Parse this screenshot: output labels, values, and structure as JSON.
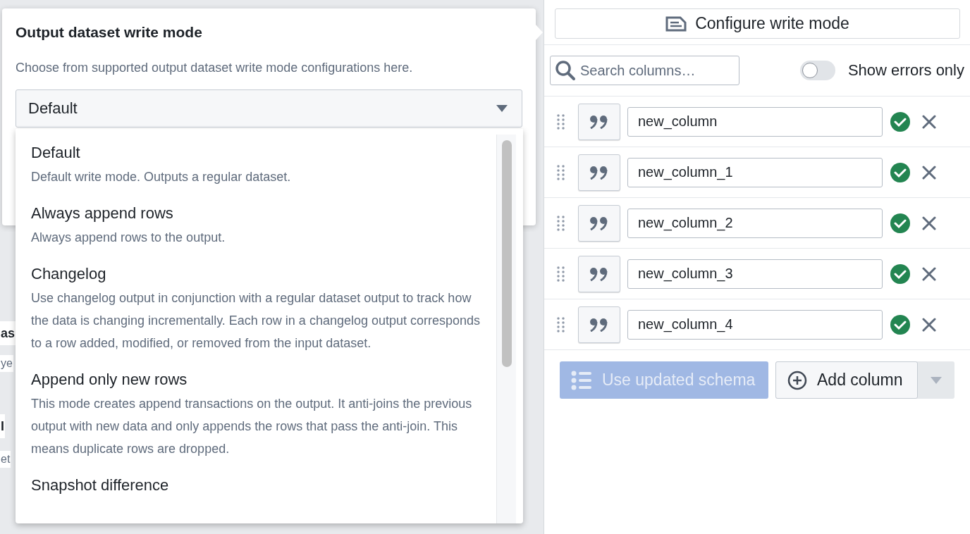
{
  "background": {
    "fragments": [
      "as",
      "ye",
      "I",
      "et"
    ]
  },
  "write_mode_popover": {
    "title": "Output dataset write mode",
    "description": "Choose from supported output dataset write mode configurations here.",
    "select": {
      "value": "Default"
    },
    "options": [
      {
        "label": "Default",
        "description": "Default write mode. Outputs a regular dataset."
      },
      {
        "label": "Always append rows",
        "description": "Always append rows to the output."
      },
      {
        "label": "Changelog",
        "description": "Use changelog output in conjunction with a regular dataset output to track how the data is changing incrementally. Each row in a changelog output corresponds to a row added, modified, or removed from the input dataset."
      },
      {
        "label": "Append only new rows",
        "description": "This mode creates append transactions on the output. It anti-joins the previous output with new data and only appends the rows that pass the anti-join. This means duplicate rows are dropped."
      },
      {
        "label": "Snapshot difference"
      }
    ]
  },
  "configure_button": {
    "label": "Configure write mode"
  },
  "search": {
    "placeholder": "Search columns…"
  },
  "errors_toggle": {
    "label": "Show errors only",
    "on": false
  },
  "columns": [
    {
      "name": "new_column",
      "valid": true
    },
    {
      "name": "new_column_1",
      "valid": true
    },
    {
      "name": "new_column_2",
      "valid": true
    },
    {
      "name": "new_column_3",
      "valid": true
    },
    {
      "name": "new_column_4",
      "valid": true
    }
  ],
  "use_schema_button": {
    "label": "Use updated schema",
    "disabled": true
  },
  "add_column_button": {
    "label": "Add column"
  }
}
